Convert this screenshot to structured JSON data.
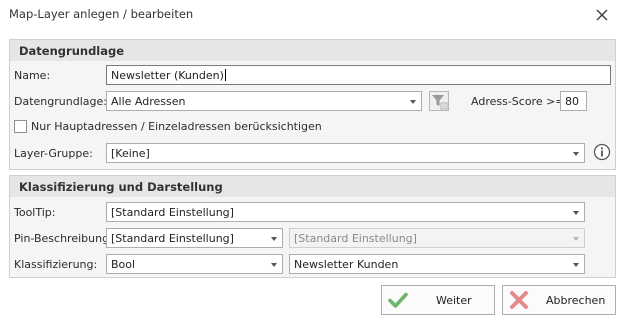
{
  "dialog": {
    "title": "Map-Layer anlegen / bearbeiten"
  },
  "section_data": {
    "header": "Datengrundlage",
    "name_label": "Name:",
    "name_value": "Newsletter (Kunden)",
    "datengrundlage_label": "Datengrundlage:",
    "datengrundlage_value": "Alle Adressen",
    "adress_score_label": "Adress-Score >=",
    "adress_score_value": "80",
    "checkbox_label": "Nur Hauptadressen / Einzeladressen berücksichtigen",
    "checkbox_checked": false,
    "layer_gruppe_label": "Layer-Gruppe:",
    "layer_gruppe_value": "[Keine]"
  },
  "section_display": {
    "header": "Klassifizierung und Darstellung",
    "tooltip_label": "ToolTip:",
    "tooltip_value": "[Standard Einstellung]",
    "pin_label": "Pin-Beschreibung:",
    "pin_value": "[Standard Einstellung]",
    "pin_value2": "[Standard Einstellung]",
    "klass_label": "Klassifizierung:",
    "klass_value": "Bool",
    "klass_value2": "Newsletter Kunden"
  },
  "buttons": {
    "ok_label": "Weiter",
    "cancel_label": "Abbrechen"
  },
  "icons": {
    "close": "close-icon",
    "filter": "filter-icon",
    "info": "info-icon",
    "ok": "checkmark-icon",
    "cancel": "x-icon"
  },
  "colors": {
    "ok_green": "#6cb66c",
    "cancel_red": "#e58a8a"
  }
}
